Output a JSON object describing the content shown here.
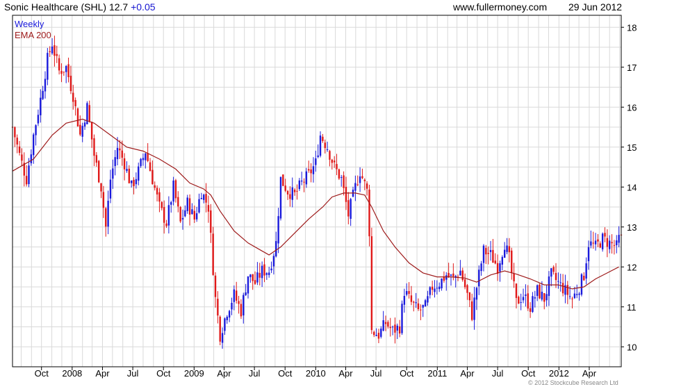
{
  "header": {
    "title": "Sonic Healthcare (SHL) 12.7",
    "change": "+0.05",
    "site": "www.fullermoney.com",
    "date": "29 Jun 2012"
  },
  "copyright": "© 2012 Stockcube Research Ltd",
  "colors": {
    "up": "#1a1adc",
    "down": "#e01818",
    "ema": "#9e1a1a",
    "grid": "#d9d9d9",
    "axis": "#000000"
  },
  "chart_data": {
    "type": "candlestick",
    "title": "Sonic Healthcare (SHL) 12.7 +0.05",
    "legend": [
      "Weekly",
      "EMA 200"
    ],
    "legend_position": "top-left",
    "ylim": [
      9.5,
      18.3
    ],
    "yticks": [
      10,
      11,
      12,
      13,
      14,
      15,
      16,
      17,
      18
    ],
    "xlim": [
      "2007-07-06",
      "2012-07-06"
    ],
    "xticks": [
      {
        "label": "Oct",
        "date": "2007-10-01"
      },
      {
        "label": "2008",
        "date": "2008-01-01"
      },
      {
        "label": "Apr",
        "date": "2008-04-01"
      },
      {
        "label": "Jul",
        "date": "2008-07-01"
      },
      {
        "label": "Oct",
        "date": "2008-10-01"
      },
      {
        "label": "2009",
        "date": "2009-01-01"
      },
      {
        "label": "Apr",
        "date": "2009-04-01"
      },
      {
        "label": "Jul",
        "date": "2009-07-01"
      },
      {
        "label": "Oct",
        "date": "2009-10-01"
      },
      {
        "label": "2010",
        "date": "2010-01-01"
      },
      {
        "label": "Apr",
        "date": "2010-04-01"
      },
      {
        "label": "Jul",
        "date": "2010-07-01"
      },
      {
        "label": "Oct",
        "date": "2010-10-01"
      },
      {
        "label": "2011",
        "date": "2011-01-01"
      },
      {
        "label": "Apr",
        "date": "2011-04-01"
      },
      {
        "label": "Jul",
        "date": "2011-07-01"
      },
      {
        "label": "Oct",
        "date": "2011-10-01"
      },
      {
        "label": "2012",
        "date": "2012-01-01"
      },
      {
        "label": "Apr",
        "date": "2012-04-01"
      }
    ],
    "grid": true,
    "close_points": [
      [
        "2007-07-06",
        15.5
      ],
      [
        "2007-07-27",
        14.8
      ],
      [
        "2007-08-17",
        14.2
      ],
      [
        "2007-09-07",
        15.3
      ],
      [
        "2007-09-28",
        16.2
      ],
      [
        "2007-10-19",
        17.2
      ],
      [
        "2007-11-02",
        17.6
      ],
      [
        "2007-11-23",
        16.9
      ],
      [
        "2007-12-14",
        17.0
      ],
      [
        "2008-01-04",
        16.3
      ],
      [
        "2008-01-25",
        15.3
      ],
      [
        "2008-02-15",
        16.0
      ],
      [
        "2008-03-07",
        14.8
      ],
      [
        "2008-03-28",
        14.0
      ],
      [
        "2008-04-11",
        13.0
      ],
      [
        "2008-04-25",
        14.2
      ],
      [
        "2008-05-16",
        15.0
      ],
      [
        "2008-06-06",
        14.6
      ],
      [
        "2008-06-27",
        14.0
      ],
      [
        "2008-07-18",
        14.4
      ],
      [
        "2008-08-08",
        14.9
      ],
      [
        "2008-08-29",
        14.2
      ],
      [
        "2008-09-19",
        13.5
      ],
      [
        "2008-10-10",
        13.1
      ],
      [
        "2008-10-31",
        14.0
      ],
      [
        "2008-11-21",
        13.1
      ],
      [
        "2008-12-12",
        13.6
      ],
      [
        "2009-01-02",
        13.2
      ],
      [
        "2009-01-23",
        13.9
      ],
      [
        "2009-02-13",
        13.5
      ],
      [
        "2009-03-06",
        11.2
      ],
      [
        "2009-03-20",
        10.3
      ],
      [
        "2009-04-10",
        10.9
      ],
      [
        "2009-05-01",
        11.3
      ],
      [
        "2009-05-22",
        10.9
      ],
      [
        "2009-06-12",
        11.8
      ],
      [
        "2009-07-03",
        11.6
      ],
      [
        "2009-07-24",
        11.9
      ],
      [
        "2009-08-14",
        11.9
      ],
      [
        "2009-09-04",
        12.6
      ],
      [
        "2009-09-18",
        14.2
      ],
      [
        "2009-10-09",
        13.9
      ],
      [
        "2009-10-30",
        13.8
      ],
      [
        "2009-11-20",
        14.1
      ],
      [
        "2009-12-11",
        14.3
      ],
      [
        "2010-01-01",
        14.6
      ],
      [
        "2010-01-15",
        15.3
      ],
      [
        "2010-02-05",
        15.0
      ],
      [
        "2010-02-26",
        14.5
      ],
      [
        "2010-03-19",
        14.2
      ],
      [
        "2010-04-09",
        13.3
      ],
      [
        "2010-04-30",
        14.0
      ],
      [
        "2010-05-14",
        14.4
      ],
      [
        "2010-06-04",
        13.9
      ],
      [
        "2010-06-11",
        12.9
      ],
      [
        "2010-06-18",
        10.4
      ],
      [
        "2010-07-09",
        10.3
      ],
      [
        "2010-07-30",
        10.6
      ],
      [
        "2010-08-20",
        10.4
      ],
      [
        "2010-09-10",
        10.5
      ],
      [
        "2010-09-24",
        11.4
      ],
      [
        "2010-10-15",
        11.1
      ],
      [
        "2010-11-05",
        10.9
      ],
      [
        "2010-11-26",
        11.0
      ],
      [
        "2010-12-17",
        11.5
      ],
      [
        "2011-01-07",
        11.6
      ],
      [
        "2011-01-28",
        11.8
      ],
      [
        "2011-02-18",
        11.7
      ],
      [
        "2011-03-11",
        11.9
      ],
      [
        "2011-04-01",
        11.3
      ],
      [
        "2011-04-15",
        10.8
      ],
      [
        "2011-04-29",
        11.5
      ],
      [
        "2011-05-20",
        12.4
      ],
      [
        "2011-06-10",
        12.3
      ],
      [
        "2011-07-01",
        12.0
      ],
      [
        "2011-07-22",
        12.6
      ],
      [
        "2011-08-05",
        12.2
      ],
      [
        "2011-08-26",
        11.1
      ],
      [
        "2011-09-16",
        11.3
      ],
      [
        "2011-10-07",
        11.0
      ],
      [
        "2011-10-28",
        11.4
      ],
      [
        "2011-11-18",
        11.2
      ],
      [
        "2011-12-09",
        11.8
      ],
      [
        "2011-12-30",
        11.6
      ],
      [
        "2012-01-20",
        11.4
      ],
      [
        "2012-02-10",
        11.2
      ],
      [
        "2012-03-02",
        11.5
      ],
      [
        "2012-03-16",
        11.8
      ],
      [
        "2012-03-30",
        12.6
      ],
      [
        "2012-04-20",
        12.5
      ],
      [
        "2012-05-11",
        12.7
      ],
      [
        "2012-06-01",
        12.6
      ],
      [
        "2012-06-22",
        12.5
      ],
      [
        "2012-06-29",
        12.7
      ]
    ],
    "ema_points": [
      [
        "2007-07-06",
        14.4
      ],
      [
        "2007-09-07",
        14.7
      ],
      [
        "2007-11-02",
        15.3
      ],
      [
        "2007-12-14",
        15.6
      ],
      [
        "2008-02-01",
        15.7
      ],
      [
        "2008-03-07",
        15.6
      ],
      [
        "2008-04-25",
        15.3
      ],
      [
        "2008-06-13",
        15.0
      ],
      [
        "2008-08-01",
        14.9
      ],
      [
        "2008-09-19",
        14.7
      ],
      [
        "2008-11-07",
        14.45
      ],
      [
        "2008-12-19",
        14.1
      ],
      [
        "2009-01-30",
        13.95
      ],
      [
        "2009-02-20",
        13.8
      ],
      [
        "2009-03-20",
        13.4
      ],
      [
        "2009-05-01",
        12.9
      ],
      [
        "2009-06-12",
        12.6
      ],
      [
        "2009-07-24",
        12.4
      ],
      [
        "2009-08-14",
        12.3
      ],
      [
        "2009-09-18",
        12.5
      ],
      [
        "2009-10-30",
        12.85
      ],
      [
        "2009-12-11",
        13.2
      ],
      [
        "2010-01-22",
        13.5
      ],
      [
        "2010-02-19",
        13.75
      ],
      [
        "2010-03-26",
        13.85
      ],
      [
        "2010-04-30",
        13.85
      ],
      [
        "2010-05-28",
        13.8
      ],
      [
        "2010-06-18",
        13.5
      ],
      [
        "2010-07-23",
        12.9
      ],
      [
        "2010-08-27",
        12.5
      ],
      [
        "2010-10-08",
        12.1
      ],
      [
        "2010-11-19",
        11.85
      ],
      [
        "2010-12-31",
        11.75
      ],
      [
        "2011-02-11",
        11.75
      ],
      [
        "2011-03-25",
        11.72
      ],
      [
        "2011-04-29",
        11.62
      ],
      [
        "2011-06-10",
        11.8
      ],
      [
        "2011-07-22",
        11.9
      ],
      [
        "2011-08-26",
        11.82
      ],
      [
        "2011-10-07",
        11.7
      ],
      [
        "2011-11-18",
        11.55
      ],
      [
        "2011-12-30",
        11.55
      ],
      [
        "2012-02-10",
        11.45
      ],
      [
        "2012-03-16",
        11.5
      ],
      [
        "2012-04-20",
        11.7
      ],
      [
        "2012-05-25",
        11.85
      ],
      [
        "2012-06-29",
        12.0
      ]
    ]
  }
}
